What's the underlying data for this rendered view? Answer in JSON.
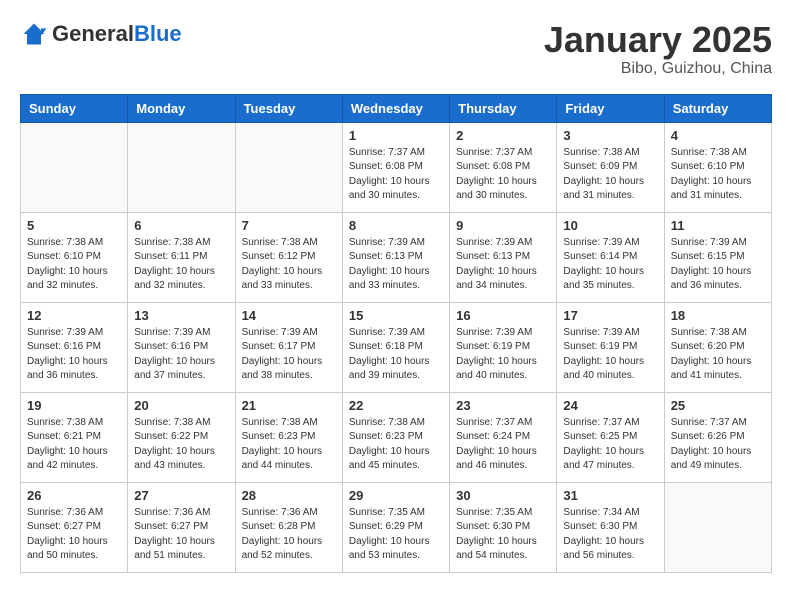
{
  "header": {
    "logo_general": "General",
    "logo_blue": "Blue",
    "month_title": "January 2025",
    "location": "Bibo, Guizhou, China"
  },
  "days_of_week": [
    "Sunday",
    "Monday",
    "Tuesday",
    "Wednesday",
    "Thursday",
    "Friday",
    "Saturday"
  ],
  "weeks": [
    [
      {
        "day": "",
        "info": ""
      },
      {
        "day": "",
        "info": ""
      },
      {
        "day": "",
        "info": ""
      },
      {
        "day": "1",
        "info": "Sunrise: 7:37 AM\nSunset: 6:08 PM\nDaylight: 10 hours\nand 30 minutes."
      },
      {
        "day": "2",
        "info": "Sunrise: 7:37 AM\nSunset: 6:08 PM\nDaylight: 10 hours\nand 30 minutes."
      },
      {
        "day": "3",
        "info": "Sunrise: 7:38 AM\nSunset: 6:09 PM\nDaylight: 10 hours\nand 31 minutes."
      },
      {
        "day": "4",
        "info": "Sunrise: 7:38 AM\nSunset: 6:10 PM\nDaylight: 10 hours\nand 31 minutes."
      }
    ],
    [
      {
        "day": "5",
        "info": "Sunrise: 7:38 AM\nSunset: 6:10 PM\nDaylight: 10 hours\nand 32 minutes."
      },
      {
        "day": "6",
        "info": "Sunrise: 7:38 AM\nSunset: 6:11 PM\nDaylight: 10 hours\nand 32 minutes."
      },
      {
        "day": "7",
        "info": "Sunrise: 7:38 AM\nSunset: 6:12 PM\nDaylight: 10 hours\nand 33 minutes."
      },
      {
        "day": "8",
        "info": "Sunrise: 7:39 AM\nSunset: 6:13 PM\nDaylight: 10 hours\nand 33 minutes."
      },
      {
        "day": "9",
        "info": "Sunrise: 7:39 AM\nSunset: 6:13 PM\nDaylight: 10 hours\nand 34 minutes."
      },
      {
        "day": "10",
        "info": "Sunrise: 7:39 AM\nSunset: 6:14 PM\nDaylight: 10 hours\nand 35 minutes."
      },
      {
        "day": "11",
        "info": "Sunrise: 7:39 AM\nSunset: 6:15 PM\nDaylight: 10 hours\nand 36 minutes."
      }
    ],
    [
      {
        "day": "12",
        "info": "Sunrise: 7:39 AM\nSunset: 6:16 PM\nDaylight: 10 hours\nand 36 minutes."
      },
      {
        "day": "13",
        "info": "Sunrise: 7:39 AM\nSunset: 6:16 PM\nDaylight: 10 hours\nand 37 minutes."
      },
      {
        "day": "14",
        "info": "Sunrise: 7:39 AM\nSunset: 6:17 PM\nDaylight: 10 hours\nand 38 minutes."
      },
      {
        "day": "15",
        "info": "Sunrise: 7:39 AM\nSunset: 6:18 PM\nDaylight: 10 hours\nand 39 minutes."
      },
      {
        "day": "16",
        "info": "Sunrise: 7:39 AM\nSunset: 6:19 PM\nDaylight: 10 hours\nand 40 minutes."
      },
      {
        "day": "17",
        "info": "Sunrise: 7:39 AM\nSunset: 6:19 PM\nDaylight: 10 hours\nand 40 minutes."
      },
      {
        "day": "18",
        "info": "Sunrise: 7:38 AM\nSunset: 6:20 PM\nDaylight: 10 hours\nand 41 minutes."
      }
    ],
    [
      {
        "day": "19",
        "info": "Sunrise: 7:38 AM\nSunset: 6:21 PM\nDaylight: 10 hours\nand 42 minutes."
      },
      {
        "day": "20",
        "info": "Sunrise: 7:38 AM\nSunset: 6:22 PM\nDaylight: 10 hours\nand 43 minutes."
      },
      {
        "day": "21",
        "info": "Sunrise: 7:38 AM\nSunset: 6:23 PM\nDaylight: 10 hours\nand 44 minutes."
      },
      {
        "day": "22",
        "info": "Sunrise: 7:38 AM\nSunset: 6:23 PM\nDaylight: 10 hours\nand 45 minutes."
      },
      {
        "day": "23",
        "info": "Sunrise: 7:37 AM\nSunset: 6:24 PM\nDaylight: 10 hours\nand 46 minutes."
      },
      {
        "day": "24",
        "info": "Sunrise: 7:37 AM\nSunset: 6:25 PM\nDaylight: 10 hours\nand 47 minutes."
      },
      {
        "day": "25",
        "info": "Sunrise: 7:37 AM\nSunset: 6:26 PM\nDaylight: 10 hours\nand 49 minutes."
      }
    ],
    [
      {
        "day": "26",
        "info": "Sunrise: 7:36 AM\nSunset: 6:27 PM\nDaylight: 10 hours\nand 50 minutes."
      },
      {
        "day": "27",
        "info": "Sunrise: 7:36 AM\nSunset: 6:27 PM\nDaylight: 10 hours\nand 51 minutes."
      },
      {
        "day": "28",
        "info": "Sunrise: 7:36 AM\nSunset: 6:28 PM\nDaylight: 10 hours\nand 52 minutes."
      },
      {
        "day": "29",
        "info": "Sunrise: 7:35 AM\nSunset: 6:29 PM\nDaylight: 10 hours\nand 53 minutes."
      },
      {
        "day": "30",
        "info": "Sunrise: 7:35 AM\nSunset: 6:30 PM\nDaylight: 10 hours\nand 54 minutes."
      },
      {
        "day": "31",
        "info": "Sunrise: 7:34 AM\nSunset: 6:30 PM\nDaylight: 10 hours\nand 56 minutes."
      },
      {
        "day": "",
        "info": ""
      }
    ]
  ]
}
